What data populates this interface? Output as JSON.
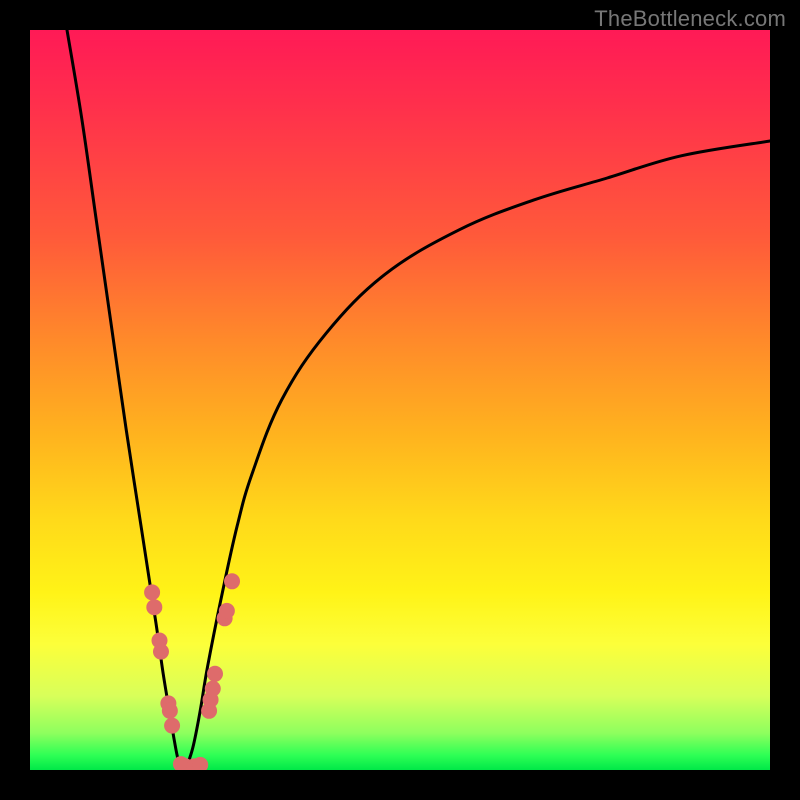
{
  "watermark": "TheBottleneck.com",
  "colors": {
    "background": "#000000",
    "curve_stroke": "#000000",
    "marker_fill": "#de6b6b",
    "gradient_stops": [
      "#ff1a56",
      "#ff2f4c",
      "#ff5a3a",
      "#ff8a2a",
      "#ffb41e",
      "#ffd91a",
      "#fff317",
      "#fcff3a",
      "#d8ff5a",
      "#8eff5e",
      "#2eff55",
      "#00e848"
    ]
  },
  "chart_data": {
    "type": "line",
    "title": "",
    "xlabel": "",
    "ylabel": "",
    "xlim": [
      0,
      100
    ],
    "ylim": [
      0,
      100
    ],
    "legend": false,
    "grid": false,
    "description": "Two black curves on a red-yellow-green vertical gradient; both descend, meet near x≈20 at y≈0, then the right curve rises asymptotically toward ~85% height. Salmon round markers cluster on both branches near the bottom of the V.",
    "series": [
      {
        "name": "left-branch",
        "x": [
          5,
          7,
          9,
          11,
          13,
          15,
          17,
          18,
          19,
          19.5,
          20,
          20.5,
          21
        ],
        "y": [
          100,
          88,
          74,
          60,
          46,
          33,
          20,
          13,
          7,
          4,
          1.5,
          0.5,
          0
        ]
      },
      {
        "name": "right-branch",
        "x": [
          21,
          22,
          23,
          24,
          26,
          28,
          30,
          34,
          40,
          48,
          58,
          68,
          78,
          88,
          100
        ],
        "y": [
          0,
          3,
          8,
          14,
          24,
          33,
          40,
          50,
          59,
          67,
          73,
          77,
          80,
          83,
          85
        ]
      }
    ],
    "markers": [
      {
        "x": 16.5,
        "y": 24
      },
      {
        "x": 16.8,
        "y": 22
      },
      {
        "x": 17.5,
        "y": 17.5
      },
      {
        "x": 17.7,
        "y": 16
      },
      {
        "x": 18.7,
        "y": 9
      },
      {
        "x": 18.9,
        "y": 8
      },
      {
        "x": 19.2,
        "y": 6
      },
      {
        "x": 20.4,
        "y": 0.8
      },
      {
        "x": 21.0,
        "y": 0.5
      },
      {
        "x": 22.2,
        "y": 0.5
      },
      {
        "x": 23.0,
        "y": 0.7
      },
      {
        "x": 24.2,
        "y": 8
      },
      {
        "x": 24.4,
        "y": 9.5
      },
      {
        "x": 24.7,
        "y": 11
      },
      {
        "x": 25.0,
        "y": 13
      },
      {
        "x": 26.3,
        "y": 20.5
      },
      {
        "x": 26.6,
        "y": 21.5
      },
      {
        "x": 27.3,
        "y": 25.5
      }
    ]
  }
}
